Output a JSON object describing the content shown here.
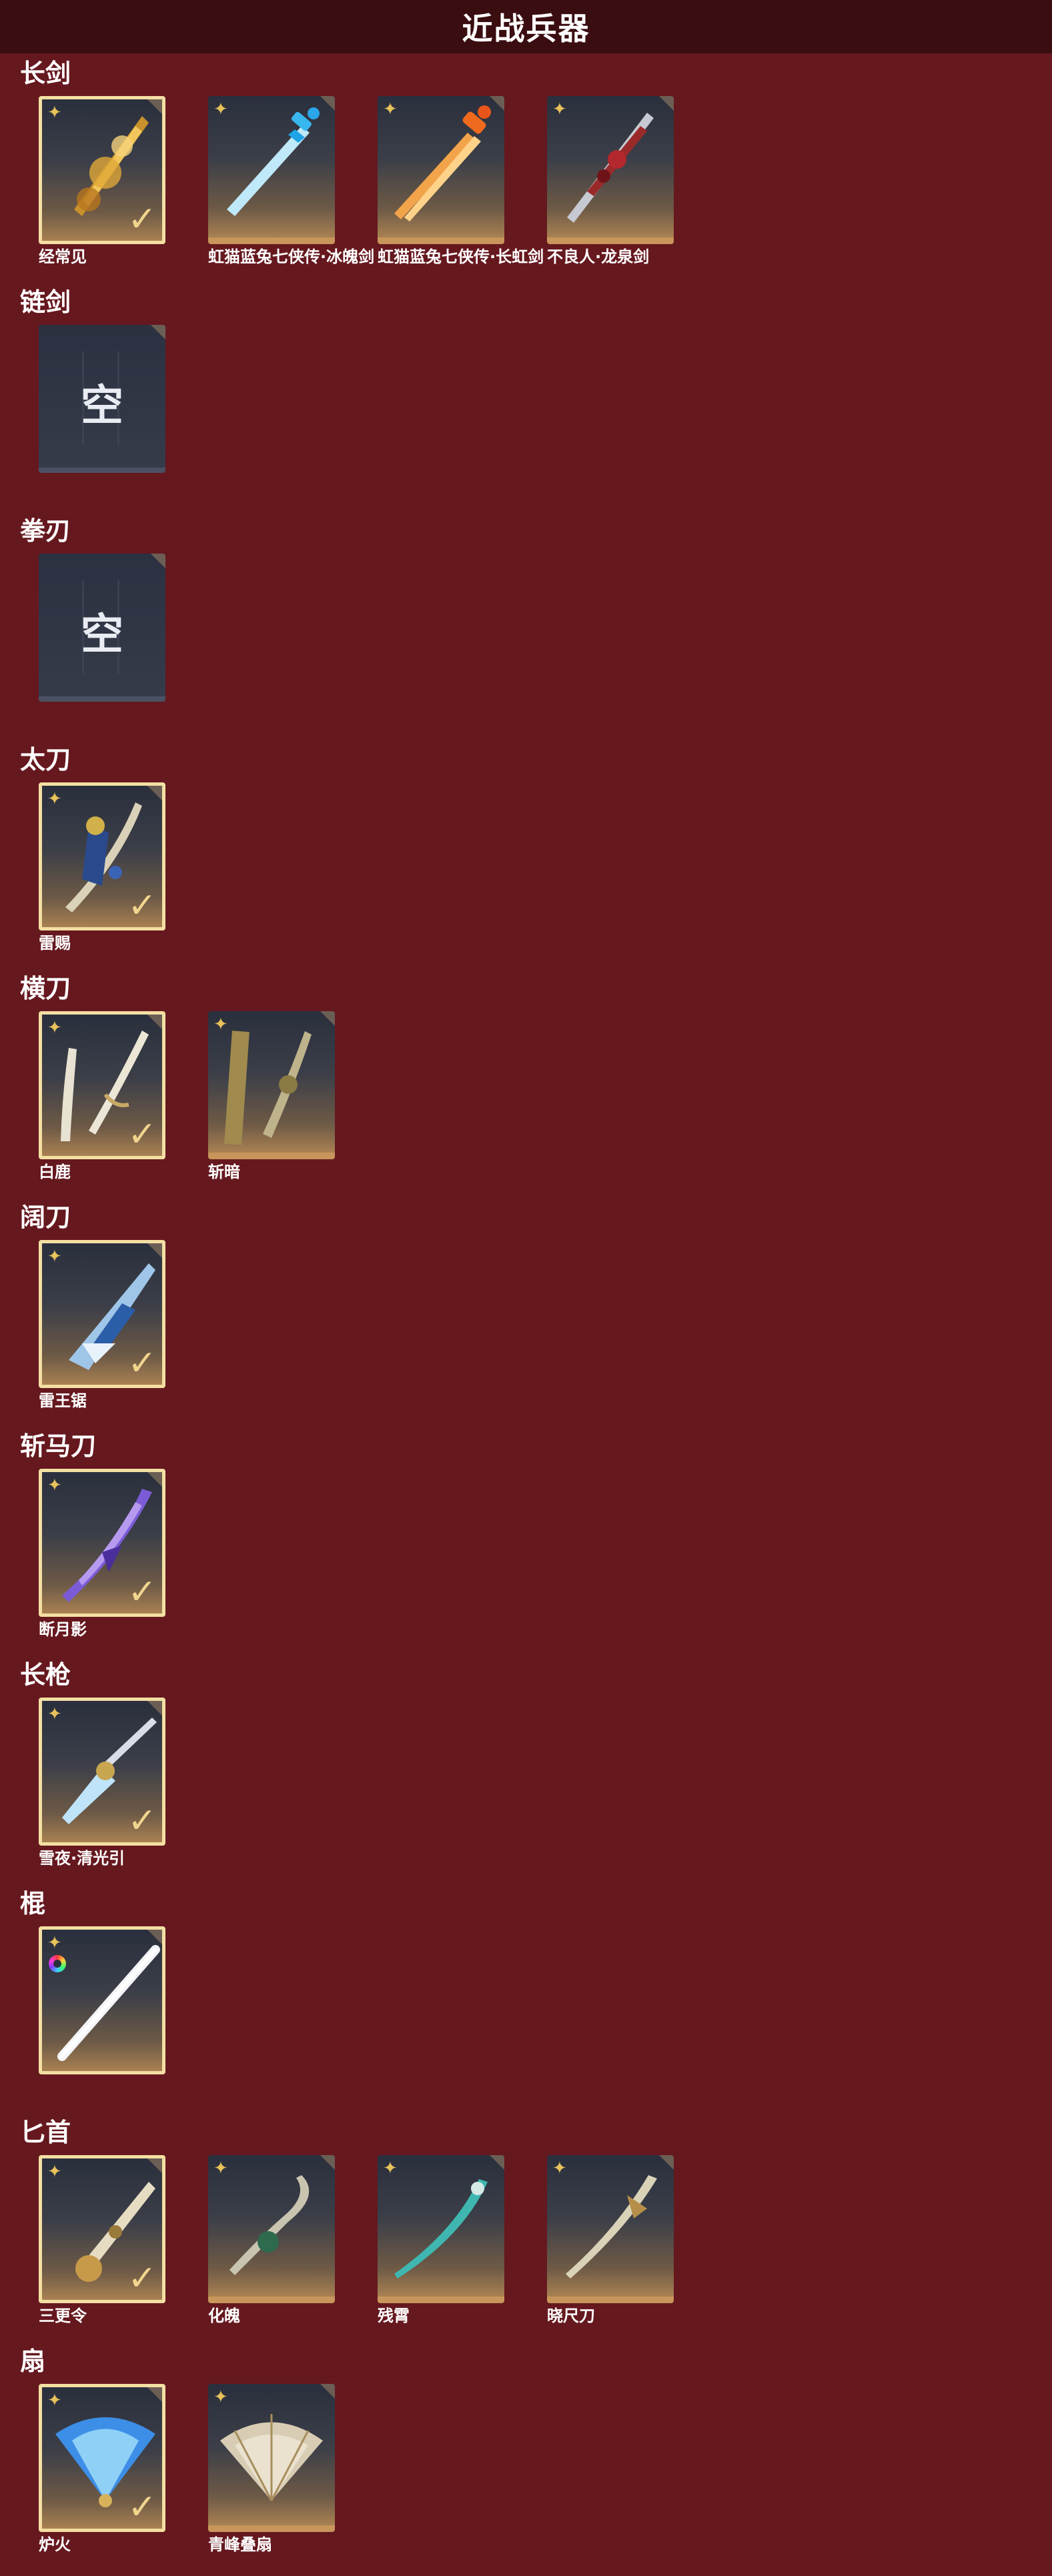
{
  "header": {
    "title": "近战兵器"
  },
  "sections": [
    {
      "category": "长剑",
      "items": [
        {
          "label": "经常见"
        },
        {
          "label": "虹猫蓝兔七侠传·冰魄剑"
        },
        {
          "label": "虹猫蓝兔七侠传·长虹剑"
        },
        {
          "label": "不良人·龙泉剑"
        }
      ]
    },
    {
      "category": "链剑",
      "empty_glyph": "空"
    },
    {
      "category": "拳刃",
      "empty_glyph": "空"
    },
    {
      "category": "太刀",
      "items": [
        {
          "label": "雷赐"
        }
      ]
    },
    {
      "category": "横刀",
      "items": [
        {
          "label": "白鹿"
        },
        {
          "label": "斩暗"
        }
      ]
    },
    {
      "category": "阔刀",
      "items": [
        {
          "label": "雷王锯"
        }
      ]
    },
    {
      "category": "斩马刀",
      "items": [
        {
          "label": "断月影"
        }
      ]
    },
    {
      "category": "长枪",
      "items": [
        {
          "label": "雪夜·清光引"
        }
      ]
    },
    {
      "category": "棍",
      "items": [
        {
          "label": ""
        }
      ]
    },
    {
      "category": "匕首",
      "items": [
        {
          "label": "三更令"
        },
        {
          "label": "化魄"
        },
        {
          "label": "残霄"
        },
        {
          "label": "晓尺刀"
        }
      ]
    },
    {
      "category": "扇",
      "items": [
        {
          "label": "炉火"
        },
        {
          "label": "青峰叠扇"
        }
      ]
    }
  ],
  "icons": {
    "rarity": "four-point-star-icon",
    "equipped": "checkmark-icon",
    "corner": "corner-tab-icon",
    "rainbow": "rainbow-ring-icon"
  },
  "colors": {
    "background": "#66181f",
    "header": "#3a0d11",
    "equipped_border": "#f4dfa3",
    "rarity_star": "#e8c25a"
  }
}
